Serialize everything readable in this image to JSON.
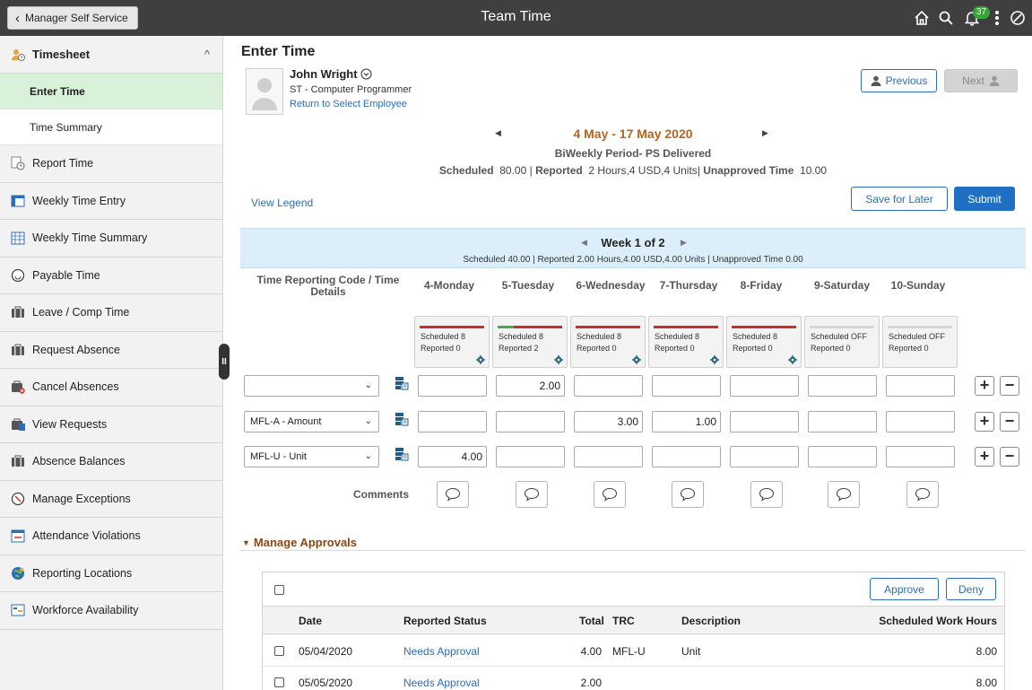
{
  "header": {
    "back_label": "Manager Self Service",
    "title": "Team Time",
    "notification_count": "37"
  },
  "sidebar": {
    "section": "Timesheet",
    "subitems": [
      "Enter Time",
      "Time Summary"
    ],
    "items": [
      {
        "label": "Report Time",
        "icon": "report-time-icon"
      },
      {
        "label": "Weekly Time Entry",
        "icon": "weekly-entry-icon"
      },
      {
        "label": "Weekly Time Summary",
        "icon": "calendar-icon"
      },
      {
        "label": "Payable Time",
        "icon": "payable-time-icon"
      },
      {
        "label": "Leave / Comp Time",
        "icon": "briefcase-icon"
      },
      {
        "label": "Request Absence",
        "icon": "briefcase-icon"
      },
      {
        "label": "Cancel Absences",
        "icon": "cancel-briefcase-icon"
      },
      {
        "label": "View Requests",
        "icon": "briefcase-calendar-icon"
      },
      {
        "label": "Absence Balances",
        "icon": "briefcase-icon"
      },
      {
        "label": "Manage Exceptions",
        "icon": "exception-icon"
      },
      {
        "label": "Attendance Violations",
        "icon": "calendar-violation-icon"
      },
      {
        "label": "Reporting Locations",
        "icon": "globe-icon"
      },
      {
        "label": "Workforce Availability",
        "icon": "availability-icon"
      }
    ]
  },
  "main": {
    "title": "Enter Time",
    "employee": {
      "name": "John Wright",
      "job": "ST - Computer Programmer",
      "return_link": "Return to Select Employee"
    },
    "previous_label": "Previous",
    "next_label": "Next",
    "period": {
      "range": "4 May - 17 May 2020",
      "type": "BiWeekly Period- PS Delivered",
      "scheduled_label": "Scheduled",
      "scheduled_value": "80.00",
      "reported_label": "Reported",
      "reported_value": "2 Hours,4 USD,4 Units",
      "unapproved_label": "Unapproved Time",
      "unapproved_value": "10.00"
    },
    "view_legend": "View Legend",
    "save_label": "Save for Later",
    "submit_label": "Submit",
    "week": {
      "label": "Week 1 of 2",
      "summary": "Scheduled 40.00 | Reported 2.00 Hours,4.00 USD,4.00 Units | Unapproved Time 0.00"
    },
    "trc_header": "Time Reporting Code / Time Details",
    "days": [
      {
        "label": "4-Monday",
        "scheduled": "Scheduled 8",
        "reported": "Reported 0",
        "progress": 0,
        "off": false
      },
      {
        "label": "5-Tuesday",
        "scheduled": "Scheduled 8",
        "reported": "Reported 2",
        "progress": 0.25,
        "off": false
      },
      {
        "label": "6-Wednesday",
        "scheduled": "Scheduled 8",
        "reported": "Reported 0",
        "progress": 0,
        "off": false
      },
      {
        "label": "7-Thursday",
        "scheduled": "Scheduled 8",
        "reported": "Reported 0",
        "progress": 0,
        "off": false
      },
      {
        "label": "8-Friday",
        "scheduled": "Scheduled 8",
        "reported": "Reported 0",
        "progress": 0,
        "off": false
      },
      {
        "label": "9-Saturday",
        "scheduled": "Scheduled OFF",
        "reported": "Reported 0",
        "progress": 0,
        "off": true
      },
      {
        "label": "10-Sunday",
        "scheduled": "Scheduled OFF",
        "reported": "Reported 0",
        "progress": 0,
        "off": true
      }
    ],
    "rows": [
      {
        "trc": "",
        "values": [
          "",
          "2.00",
          "",
          "",
          "",
          "",
          ""
        ]
      },
      {
        "trc": "MFL-A - Amount",
        "values": [
          "",
          "",
          "3.00",
          "1.00",
          "",
          "",
          ""
        ]
      },
      {
        "trc": "MFL-U - Unit",
        "values": [
          "4.00",
          "",
          "",
          "",
          "",
          "",
          ""
        ]
      }
    ],
    "comments_label": "Comments"
  },
  "approvals": {
    "title": "Manage Approvals",
    "approve_label": "Approve",
    "deny_label": "Deny",
    "columns": [
      "Date",
      "Reported Status",
      "Total",
      "TRC",
      "Description",
      "Scheduled Work Hours"
    ],
    "rows": [
      {
        "date": "05/04/2020",
        "status": "Needs Approval",
        "total": "4.00",
        "trc": "MFL-U",
        "description": "Unit",
        "hours": "8.00"
      },
      {
        "date": "05/05/2020",
        "status": "Needs Approval",
        "total": "2.00",
        "trc": "",
        "description": "",
        "hours": "8.00"
      }
    ]
  },
  "colors": {
    "header_bg": "#3f3f3f",
    "accent_blue": "#1f6fc5",
    "period_orange": "#b5651d",
    "active_green": "#d9f0d9"
  }
}
